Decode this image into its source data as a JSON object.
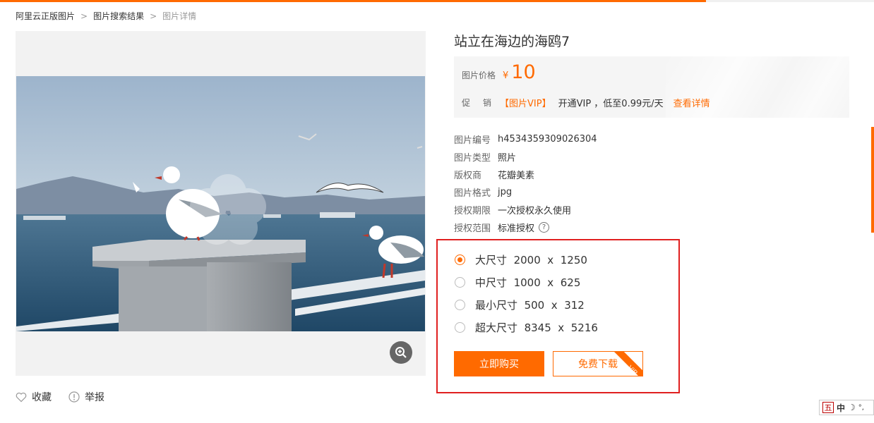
{
  "breadcrumb": {
    "items": [
      "阿里云正版图片",
      "图片搜索结果"
    ],
    "current": "图片详情",
    "separator": ">"
  },
  "image": {
    "title": "站立在海边的海鸥7",
    "zoom_icon": "zoom-in-icon"
  },
  "actions": {
    "favorite": "收藏",
    "report": "举报"
  },
  "price": {
    "label": "图片价格",
    "currency": "¥",
    "amount": "10"
  },
  "promo": {
    "label": "促销",
    "tag": "【图片VIP】",
    "text": "开通VIP ，低至0.99元/天",
    "link": "查看详情"
  },
  "meta": [
    {
      "label": "图片编号",
      "value": "h4534359309026304"
    },
    {
      "label": "图片类型",
      "value": "照片"
    },
    {
      "label": "版权商",
      "value": "花瓣美素"
    },
    {
      "label": "图片格式",
      "value": "jpg"
    },
    {
      "label": "授权期限",
      "value": "一次授权永久使用"
    },
    {
      "label": "授权范围",
      "value": "标准授权"
    }
  ],
  "sizes": [
    {
      "name": "大尺寸",
      "width": "2000",
      "x": "x",
      "height": "1250",
      "selected": true
    },
    {
      "name": "中尺寸",
      "width": "1000",
      "x": "x",
      "height": "625",
      "selected": false
    },
    {
      "name": "最小尺寸",
      "width": "500",
      "x": "x",
      "height": "312",
      "selected": false
    },
    {
      "name": "超大尺寸",
      "width": "8345",
      "x": "x",
      "height": "5216",
      "selected": false
    }
  ],
  "buttons": {
    "buy": "立即购买",
    "free_download": "免费下载",
    "vip_badge": "VIP"
  },
  "ime": {
    "logo": "五",
    "lang": "中",
    "punct": "°,"
  },
  "colors": {
    "accent": "#ff6a00",
    "highlight_border": "#e02020"
  }
}
